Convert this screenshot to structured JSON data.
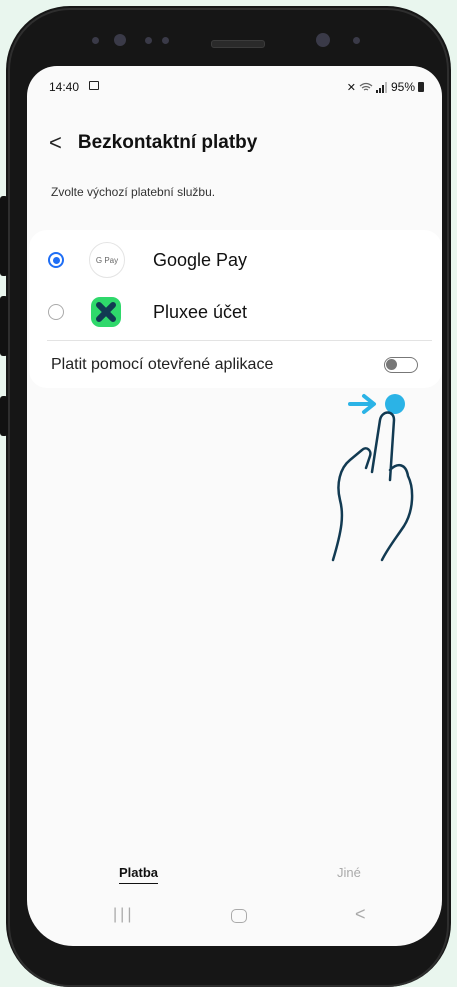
{
  "status": {
    "time": "14:40",
    "battery": "95%"
  },
  "header": {
    "back_icon": "chevron-left-icon",
    "title": "Bezkontaktní platby"
  },
  "subtitle": "Zvolte výchozí platební službu.",
  "options": [
    {
      "label": "Google Pay",
      "icon_text": "G Pay",
      "selected": true
    },
    {
      "label": "Pluxee účet",
      "selected": false
    }
  ],
  "toggle": {
    "label": "Platit pomocí otevřené aplikace",
    "on": false
  },
  "tabs": [
    {
      "label": "Platba",
      "active": true
    },
    {
      "label": "Jiné",
      "active": false
    }
  ],
  "colors": {
    "accent": "#1f6ef5",
    "pluxee": "#2fd86b",
    "hand_stroke": "#123a52",
    "arrow": "#2bb3e6"
  }
}
